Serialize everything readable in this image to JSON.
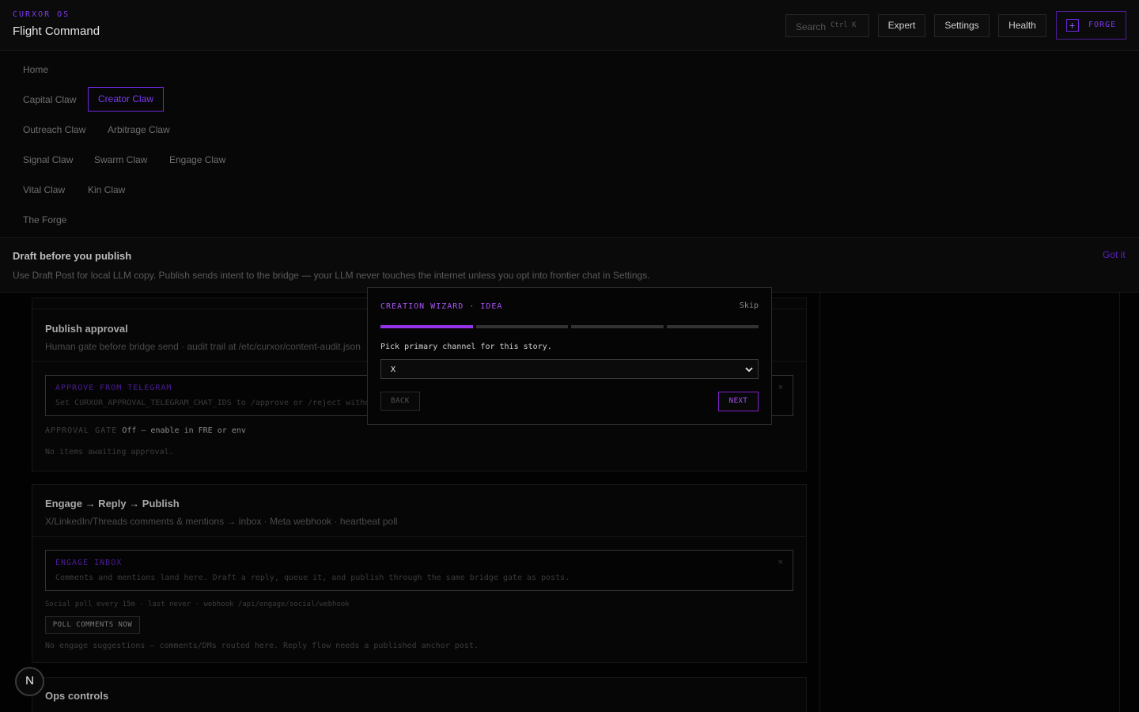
{
  "header": {
    "brand": "CURXOR OS",
    "title": "Flight Command",
    "search_placeholder": "Search",
    "search_shortcut": "Ctrl K",
    "buttons": [
      "Expert",
      "Settings",
      "Health"
    ],
    "forge_label": "FORGE",
    "forge_icon": "plus-icon"
  },
  "nav": {
    "items": [
      "Home",
      "Capital Claw",
      "Creator Claw",
      "Outreach Claw",
      "Arbitrage Claw",
      "Signal Claw",
      "Swarm Claw",
      "Engage Claw",
      "Vital Claw",
      "Kin Claw",
      "The Forge"
    ],
    "active": "Creator Claw"
  },
  "banner": {
    "title": "Draft before you publish",
    "text": "Use Draft Post for local LLM copy. Publish sends intent to the bridge — your LLM never touches the internet unless you opt into frontier chat in Settings.",
    "dismiss_label": "Got it"
  },
  "publish_approval": {
    "title": "Publish approval",
    "subtitle": "Human gate before bridge send · audit trail at /etc/curxor/content-audit.json",
    "notice_title": "APPROVE FROM TELEGRAM",
    "notice_body": "Set CURXOR_APPROVAL_TELEGRAM_CHAT_IDS to /approve or /reject witho",
    "notice_close": "×",
    "gate_key": "APPROVAL GATE",
    "gate_value": "Off — enable in FRE or env",
    "empty_text": "No items awaiting approval."
  },
  "engage": {
    "title": "Engage → Reply → Publish",
    "subtitle": "X/LinkedIn/Threads comments & mentions → inbox · Meta webhook · heartbeat poll",
    "notice_title": "ENGAGE INBOX",
    "notice_body": "Comments and mentions land here. Draft a reply, queue it, and publish through the same bridge gate as posts.",
    "notice_close": "×",
    "poll_status": "Social poll every 15m · last never · webhook /api/engage/social/webhook",
    "poll_button": "POLL COMMENTS NOW",
    "empty_text": "No engage suggestions — comments/DMs routed here. Reply flow needs a published anchor post."
  },
  "ops": {
    "title": "Ops controls"
  },
  "fab_label": "N",
  "wizard": {
    "title": "CREATION WIZARD · IDEA",
    "skip_label": "Skip",
    "steps_total": 4,
    "current_step": 1,
    "prompt": "Pick primary channel for this story.",
    "channel_value": "X",
    "back_label": "BACK",
    "next_label": "NEXT"
  },
  "colors": {
    "accent": "#a855f7",
    "accent_dim": "#6d28d9",
    "background": "#000000"
  }
}
